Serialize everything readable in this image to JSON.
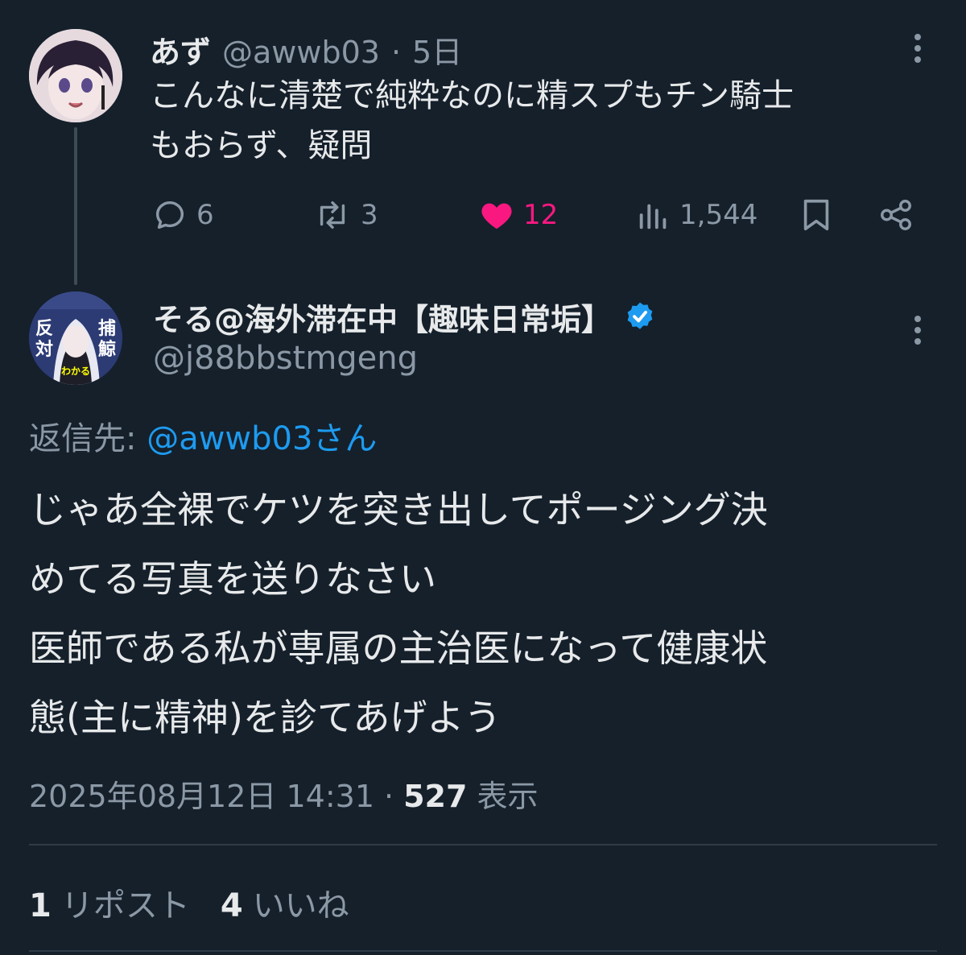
{
  "parent_tweet": {
    "display_name": "あず",
    "handle": "@awwb03",
    "separator": "·",
    "age": "5日",
    "text": "こんなに清楚で純粋なのに精スプもチン騎士\nもおらず、疑問",
    "actions": {
      "replies": "6",
      "reposts": "3",
      "likes": "12",
      "views": "1,544"
    },
    "colors": {
      "like": "#f91880",
      "muted": "#8b98a5"
    }
  },
  "main_tweet": {
    "display_name": "そる@海外滞在中【趣味日常垢】",
    "handle": "@j88bbstmgeng",
    "verified": true,
    "reply_label": "返信先:",
    "reply_to": "@awwb03さん",
    "text": "じゃあ全裸でケツを突き出してポージング決\nめてる写真を送りなさい\n医師である私が専属の主治医になって健康状\n態(主に精神)を診てあげよう",
    "timestamp": "2025年08月12日 14:31",
    "separator": "·",
    "view_count": "527",
    "view_label": "表示",
    "avatar_text": {
      "left": "反対",
      "right": "捕鯨",
      "bottom": "わかる"
    },
    "colors": {
      "verified": "#1d9bf0",
      "link": "#1d9bf0"
    }
  },
  "engagement": {
    "repost_count": "1",
    "repost_label": "リポスト",
    "like_count": "4",
    "like_label": "いいね"
  }
}
